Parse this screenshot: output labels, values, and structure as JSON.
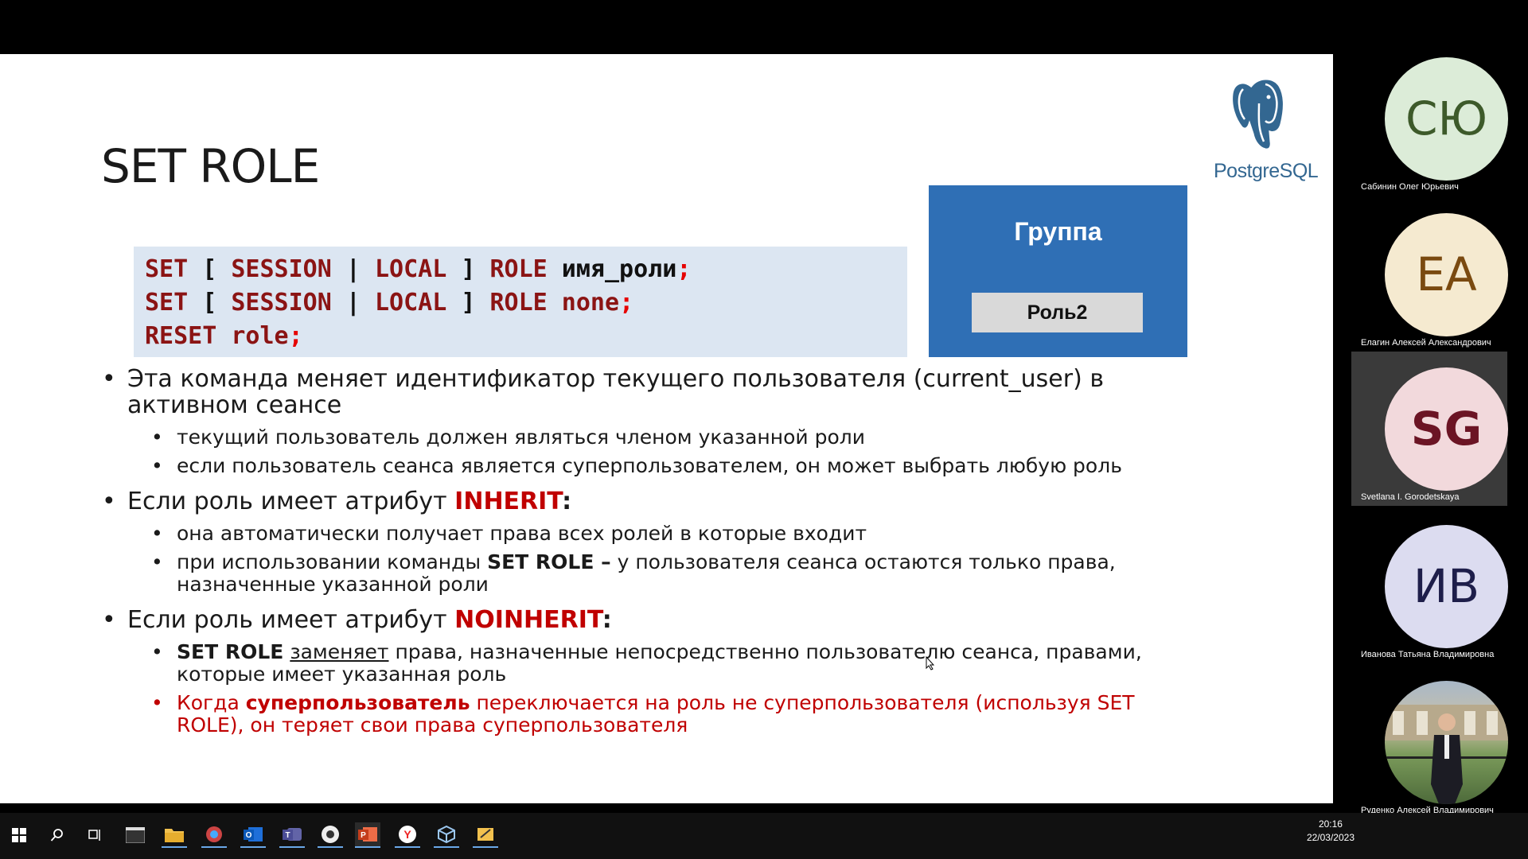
{
  "slide": {
    "title": "SET ROLE",
    "logo_text_postgre": "Postgre",
    "logo_text_sql": "SQL",
    "code": {
      "line1": {
        "a": "SET",
        "b": " [ ",
        "c": "SESSION",
        "d": " | ",
        "e": "LOCAL",
        "f": " ] ",
        "g": "ROLE",
        "h": " имя_роли",
        "i": ";"
      },
      "line2": {
        "a": "SET",
        "b": " [ ",
        "c": "SESSION",
        "d": " | ",
        "e": "LOCAL",
        "f": " ] ",
        "g": "ROLE",
        "h": " none",
        "i": ";"
      },
      "line3": {
        "a": "RESET",
        "h": " role",
        "i": ";"
      }
    },
    "group": {
      "label": "Группа",
      "role": "Роль2"
    },
    "bullets": {
      "b1": "Эта команда меняет идентификатор текущего пользователя (current_user) в активном сеансе",
      "b1_1": "текущий пользователь должен являться членом указанной роли",
      "b1_2": "если пользователь сеанса является суперпользователем, он может выбрать любую роль",
      "b2_pre": "Если роль имеет атрибут ",
      "b2_kw": "INHERIT",
      "b2_post": ":",
      "b2_1": "она автоматически получает права всех ролей в которые входит",
      "b2_2_pre": "при использовании команды ",
      "b2_2_bold": "SET ROLE –",
      "b2_2_post": " у пользователя сеанса остаются только права, назначенные указанной роли",
      "b3_pre": "Если роль имеет атрибут ",
      "b3_kw": "NOINHERIT",
      "b3_post": ":",
      "b3_1_bold": "SET ROLE",
      "b3_1_u": "заменяет",
      "b3_1_post": " права, назначенные непосредственно пользователю сеанса, правами, которые имеет указанная роль",
      "b3_2_pre": "Когда ",
      "b3_2_bold": "суперпользователь",
      "b3_2_post": " переключается на роль не суперпользователя (используя SET ROLE), он теряет свои права суперпользователя"
    }
  },
  "participants": [
    {
      "initials": "СЮ",
      "name": "Сабинин Олег Юрьевич",
      "bg": "#dcecd8",
      "fg": "#3d5a2a"
    },
    {
      "initials": "ЕА",
      "name": "Елагин Алексей Александрович",
      "bg": "#f5ead0",
      "fg": "#7a4a10"
    },
    {
      "initials": "SG",
      "name": "Svetlana I. Gorodetskaya",
      "bg": "#f2d9dc",
      "fg": "#6b1424"
    },
    {
      "initials": "ИВ",
      "name": "Иванова Татьяна Владимировна",
      "bg": "#dcdcf0",
      "fg": "#1e1e4a"
    },
    {
      "initials": "",
      "name": "Руденко Алексей Владимирович",
      "bg": "#6d8a5a",
      "fg": "#fff"
    }
  ],
  "taskbar": {
    "time": "20:16",
    "date": "22/03/2023",
    "icons": [
      "windows-start-icon",
      "search-icon",
      "task-view-icon",
      "terminal-icon",
      "file-explorer-icon",
      "app-icon",
      "outlook-icon",
      "teams-icon",
      "browser-icon",
      "powerpoint-icon",
      "yandex-browser-icon",
      "virtualbox-icon",
      "app-icon-2"
    ]
  },
  "colors": {
    "accent_blue": "#2f6fb5",
    "code_bg": "#dce6f2",
    "keyword_red": "#c00000"
  }
}
